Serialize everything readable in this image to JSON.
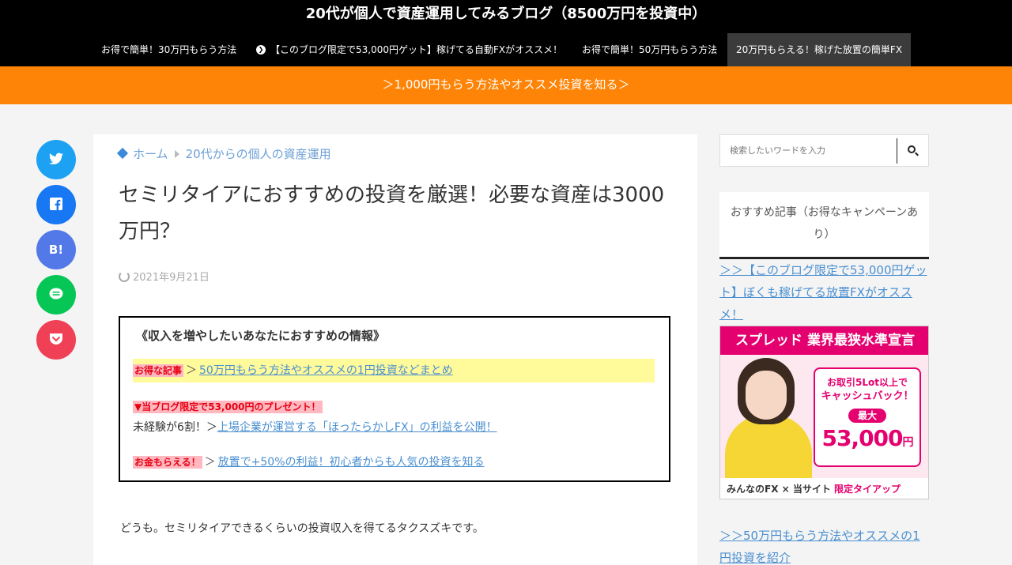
{
  "site": {
    "title": "20代が個人で資産運用してみるブログ（8500万円を投資中）"
  },
  "nav": {
    "items": [
      {
        "label": "お得で簡単！30万円もらう方法"
      },
      {
        "label": "【このブログ限定で53,000円ゲット】稼げてる自動FXがオススメ！"
      },
      {
        "label": "お得で簡単！50万円もらう方法"
      },
      {
        "label": "20万円もらえる！稼げた放置の簡単FX"
      }
    ]
  },
  "banner": {
    "text": "＞1,000円もらう方法やオススメ投資を知る＞"
  },
  "share": {
    "buttons": [
      {
        "name": "twitter",
        "color": "#1da1f2",
        "glyph": "🐦"
      },
      {
        "name": "facebook",
        "color": "#1877f2",
        "glyph": "f"
      },
      {
        "name": "hatena",
        "color": "#5279e7",
        "glyph": "B!"
      },
      {
        "name": "line",
        "color": "#06c755",
        "glyph": "◯"
      },
      {
        "name": "pocket",
        "color": "#ef4056",
        "glyph": "⌄"
      }
    ]
  },
  "breadcrumb": {
    "home": "ホーム",
    "category": "20代からの個人の資産運用"
  },
  "post": {
    "title": "セミリタイアにおすすめの投資を厳選！必要な資産は3000万円？",
    "date": "2021年9月21日",
    "intro": "どうも。セミリタイアできるくらいの投資収入を得てるタクスズキです。"
  },
  "infobox": {
    "heading": "《収入を増やしたいあなたにおすすめの情報》",
    "row1_tag": "お得な記事",
    "row1_gt": "＞",
    "row1_link": "50万円もらう方法やオススメの1円投資などまとめ",
    "row2_tag": "▼当ブログ限定で53,000円のプレゼント！",
    "row2_text": "未経験が6割！＞",
    "row2_link": "上場企業が運営する「ほったらかしFX」の利益を公開！",
    "row3_tag": "お金もらえる！",
    "row3_gt": "＞",
    "row3_link": "放置で+50%の利益！初心者からも人気の投資を知る"
  },
  "sidebar": {
    "search_placeholder": "検索したいワードを入力",
    "widget_title": "おすすめ記事（お得なキャンペーンあり）",
    "link1": "＞＞【このブログ限定で53,000円ゲット】ぼくも稼げてる放置FXがオススメ！",
    "link2": "＞＞50万円もらう方法やオススメの1円投資を紹介"
  },
  "ad": {
    "headline": "スプレッド 業界最狭水準宣言",
    "badge_line1": "お取引5Lot以上で",
    "badge_line2": "キャッシュバック！",
    "badge_pill": "最大",
    "badge_amount": "53,000",
    "badge_unit": "円",
    "footer_brand": "みんなのFX",
    "footer_x": " × 当サイト ",
    "footer_tieup": "限定タイアップ"
  }
}
